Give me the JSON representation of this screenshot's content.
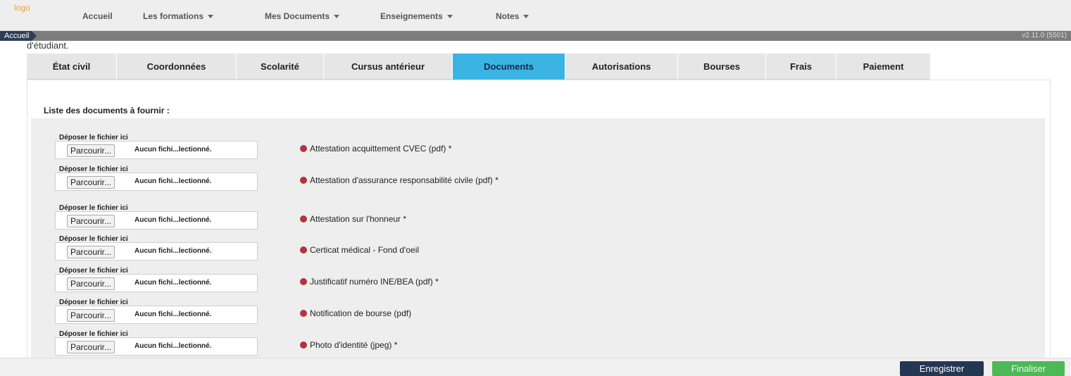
{
  "header": {
    "logo_text": "logo",
    "nav": [
      {
        "label": "Accueil"
      },
      {
        "label": "Les formations"
      },
      {
        "label": "Mes Documents"
      },
      {
        "label": "Enseignements"
      },
      {
        "label": "Notes"
      }
    ]
  },
  "breadcrumb": {
    "label": "Accueil",
    "version": "v2.11.0 (5501)"
  },
  "intro_text": "d'étudiant.",
  "tabs": [
    {
      "label": "État civil"
    },
    {
      "label": "Coordonnées"
    },
    {
      "label": "Scolarité"
    },
    {
      "label": "Cursus antérieur"
    },
    {
      "label": "Documents",
      "active": true
    },
    {
      "label": "Autorisations"
    },
    {
      "label": "Bourses"
    },
    {
      "label": "Frais"
    },
    {
      "label": "Paiement"
    }
  ],
  "documents": {
    "heading": "Liste des documents à fournir :",
    "drop_label": "Déposer le fichier ici",
    "browse_label": "Parcourir...",
    "file_status": "Aucun fichi...lectionné.",
    "items": [
      {
        "name": "Attestation acquittement CVEC (pdf) *"
      },
      {
        "name": "Attestation d'assurance responsabilité civile (pdf) *"
      },
      {
        "name": "Attestation sur l'honneur *"
      },
      {
        "name": "Certicat médical - Fond d'oeil"
      },
      {
        "name": "Justificatif numéro INE/BEA (pdf) *"
      },
      {
        "name": "Notification de bourse (pdf)"
      },
      {
        "name": "Photo d'identité (jpeg) *"
      }
    ]
  },
  "footer": {
    "save_label": "Enregistrer",
    "finalize_label": "Finaliser"
  },
  "colors": {
    "active_tab": "#3bb4e4",
    "required_dot": "#b0353c",
    "save_button": "#243752",
    "finalize_button": "#4cb856"
  }
}
